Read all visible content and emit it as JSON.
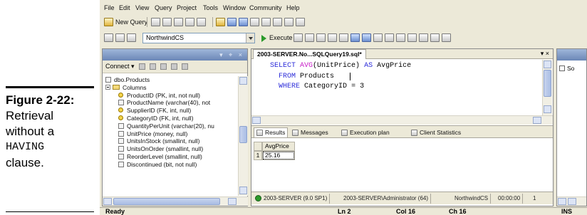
{
  "caption": {
    "figure_number": "Figure 2-22:",
    "line1": "Retrieval",
    "line2": "without a",
    "keyword": "HAVING",
    "line3": "clause."
  },
  "menu": [
    "File",
    "Edit",
    "View",
    "Query",
    "Project",
    "Tools",
    "Window",
    "Community",
    "Help"
  ],
  "toolbar": {
    "new_query_label": "New Query",
    "database": "NorthwindCS",
    "execute_label": "Execute"
  },
  "object_explorer": {
    "connect_label": "Connect ▾",
    "tree": [
      {
        "label": "dbo.Products",
        "icon": "table-icon",
        "indent": 0
      },
      {
        "label": "Columns",
        "icon": "folder-icon",
        "indent": 1
      },
      {
        "label": "ProductID (PK, int, not null)",
        "icon": "primary-key-icon",
        "indent": 2
      },
      {
        "label": "ProductName (varchar(40), not",
        "icon": "column-icon",
        "indent": 2
      },
      {
        "label": "SupplierID (FK, int, null)",
        "icon": "foreign-key-icon",
        "indent": 2
      },
      {
        "label": "CategoryID (FK, int, null)",
        "icon": "foreign-key-icon",
        "indent": 2
      },
      {
        "label": "QuantityPerUnit (varchar(20), nu",
        "icon": "column-icon",
        "indent": 2
      },
      {
        "label": "UnitPrice (money, null)",
        "icon": "column-icon",
        "indent": 2
      },
      {
        "label": "UnitsInStock (smallint, null)",
        "icon": "column-icon",
        "indent": 2
      },
      {
        "label": "UnitsOnOrder (smallint, null)",
        "icon": "column-icon",
        "indent": 2
      },
      {
        "label": "ReorderLevel (smallint, null)",
        "icon": "column-icon",
        "indent": 2
      },
      {
        "label": "Discontinued (bit, not null)",
        "icon": "column-icon",
        "indent": 2
      }
    ]
  },
  "document": {
    "tab_title": "2003-SERVER.No...SQLQuery19.sql*",
    "tab_controls": "▾ ×",
    "code": {
      "line1": {
        "k1": "SELECT",
        "fn": "AVG",
        "arg": "(UnitPrice)",
        "k2": "AS",
        "alias": "AvgPrice"
      },
      "line2": {
        "k1": "FROM",
        "table": "Products"
      },
      "line3": {
        "k1": "WHERE",
        "col": "CategoryID",
        "op": "=",
        "val": "3"
      }
    },
    "results_tabs": [
      "Results",
      "Messages",
      "Execution plan",
      "Client Statistics"
    ],
    "grid": {
      "column": "AvgPrice",
      "row_number": "1",
      "value": "25.16"
    },
    "status": {
      "server": "2003-SERVER (9.0 SP1)",
      "user": "2003-SERVER\\Administrator (64)",
      "database": "NorthwindCS",
      "time": "00:00:00",
      "rows": "1"
    }
  },
  "right_panel": {
    "title": "",
    "item": "So"
  },
  "statusbar": {
    "ready": "Ready",
    "ln": "Ln 2",
    "col": "Col 16",
    "ch": "Ch 16",
    "ins": "INS"
  },
  "colors": {
    "keyword": "#2b2bd9",
    "function": "#c81ec8",
    "chrome": "#ece9d8",
    "panel_title": "#6b86b7"
  }
}
